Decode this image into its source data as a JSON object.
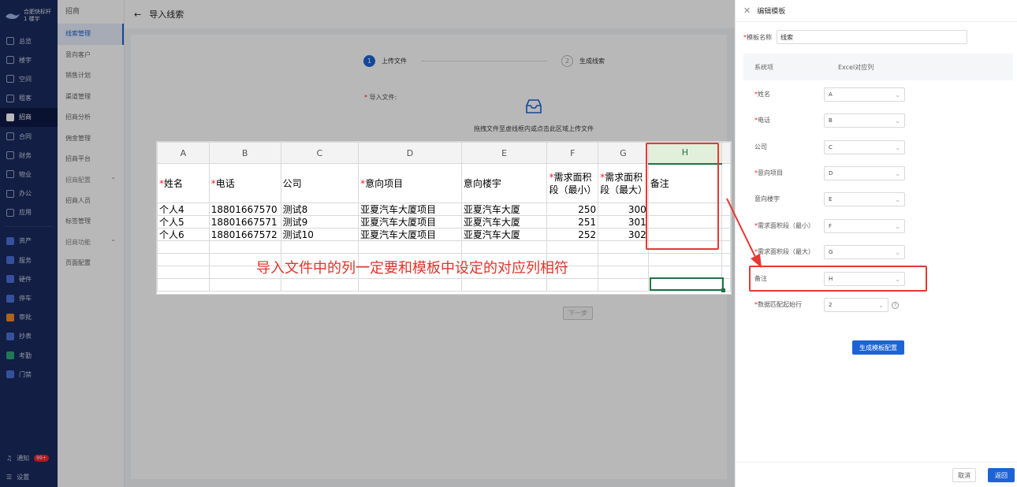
{
  "sidebar": {
    "org_line1": "合肥快标杆",
    "org_line2": "1 楼宇",
    "items": [
      {
        "label": "总览",
        "icon": "clock-icon"
      },
      {
        "label": "楼宇",
        "icon": "building-icon"
      },
      {
        "label": "空间",
        "icon": "box-icon"
      },
      {
        "label": "租客",
        "icon": "users-icon"
      },
      {
        "label": "招商",
        "icon": "tag-icon"
      },
      {
        "label": "合同",
        "icon": "contract-icon"
      },
      {
        "label": "财务",
        "icon": "finance-icon"
      },
      {
        "label": "物业",
        "icon": "property-icon"
      },
      {
        "label": "办公",
        "icon": "monitor-icon"
      },
      {
        "label": "应用",
        "icon": "apps-icon"
      }
    ],
    "apps": [
      {
        "label": "资产",
        "color": "#4a6fd8"
      },
      {
        "label": "服务",
        "color": "#4a6fd8"
      },
      {
        "label": "硬件",
        "color": "#4a6fd8"
      },
      {
        "label": "停车",
        "color": "#4a6fd8"
      },
      {
        "label": "审批",
        "color": "#f08a24"
      },
      {
        "label": "抄表",
        "color": "#4a6fd8"
      },
      {
        "label": "考勤",
        "color": "#2aa876"
      },
      {
        "label": "门禁",
        "color": "#4a6fd8"
      }
    ],
    "notify_label": "通知",
    "notify_badge": "99+",
    "settings_label": "设置"
  },
  "submenu": {
    "head": "招商",
    "items": [
      "线索管理",
      "意向客户",
      "销售计划",
      "渠道管理",
      "招商分析",
      "佣金管理",
      "招商平台"
    ],
    "group1": "招商配置",
    "group1_items": [
      "招商人员",
      "标签管理"
    ],
    "group2": "招商功能",
    "group2_items": [
      "页面配置"
    ]
  },
  "main": {
    "title": "导入线索",
    "step1_num": "1",
    "step1_label": "上传文件",
    "step2_num": "2",
    "step2_label": "生成线索",
    "import_label": "导入文件:",
    "upload_text": "拖拽文件至虚线框内或点击此区域上传文件",
    "next_label": "下一步"
  },
  "excel": {
    "columns": [
      "A",
      "B",
      "C",
      "D",
      "E",
      "F",
      "G",
      "H"
    ],
    "header_row": [
      {
        "text": "姓名",
        "req": true
      },
      {
        "text": "电话",
        "req": true
      },
      {
        "text": "公司",
        "req": false
      },
      {
        "text": "意向项目",
        "req": true
      },
      {
        "text": "意向楼宇",
        "req": false
      },
      {
        "text": "需求面积段（最小）",
        "req": true
      },
      {
        "text": "需求面积段（最大）",
        "req": true
      },
      {
        "text": "备注",
        "req": false
      }
    ],
    "rows": [
      [
        "个人4",
        "18801667570",
        "测试8",
        "亚夏汽车大厦项目",
        "亚夏汽车大厦",
        "250",
        "300",
        ""
      ],
      [
        "个人5",
        "18801667571",
        "测试9",
        "亚夏汽车大厦项目",
        "亚夏汽车大厦",
        "251",
        "301",
        ""
      ],
      [
        "个人6",
        "18801667572",
        "测试10",
        "亚夏汽车大厦项目",
        "亚夏汽车大厦",
        "252",
        "302",
        ""
      ]
    ],
    "note": "导入文件中的列一定要和模板中设定的对应列相符"
  },
  "drawer": {
    "title": "编辑模板",
    "name_label": "模板名称",
    "name_value": "线索",
    "col_system": "系统项",
    "col_excel": "Excel对应列",
    "mappings": [
      {
        "label": "姓名",
        "req": true,
        "value": "A"
      },
      {
        "label": "电话",
        "req": true,
        "value": "B"
      },
      {
        "label": "公司",
        "req": false,
        "value": "C"
      },
      {
        "label": "意向项目",
        "req": true,
        "value": "D"
      },
      {
        "label": "意向楼宇",
        "req": false,
        "value": "E"
      },
      {
        "label": "需求面积段（最小）",
        "req": true,
        "value": "F"
      },
      {
        "label": "需求面积段（最大）",
        "req": true,
        "value": "G"
      },
      {
        "label": "备注",
        "req": false,
        "value": "H"
      },
      {
        "label": "数据匹配起始行",
        "req": true,
        "value": "2"
      }
    ],
    "generate_label": "生成模板配置",
    "cancel_label": "取消",
    "back_label": "返回"
  },
  "colors": {
    "sidebar_bg": "#1a2a5e",
    "primary": "#1d63d6",
    "highlight_red": "#e53935",
    "excel_green": "#217346"
  }
}
